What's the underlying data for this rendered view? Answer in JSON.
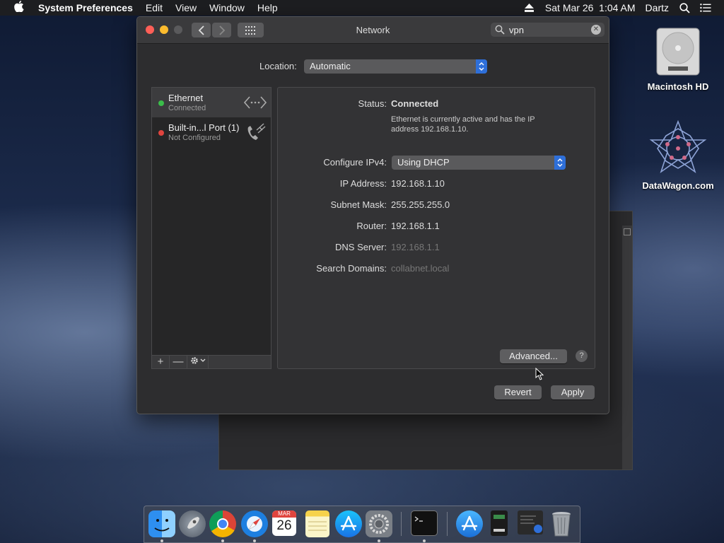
{
  "menubar": {
    "app": "System Preferences",
    "items": [
      "Edit",
      "View",
      "Window",
      "Help"
    ],
    "datetime": "Sat Mar 26  1:04 AM",
    "user": "Dartz"
  },
  "window": {
    "title": "Network",
    "search_value": "vpn",
    "location_label": "Location:",
    "location_value": "Automatic"
  },
  "services": [
    {
      "name": "Ethernet",
      "status": "Connected",
      "status_color": "#3bbd4a"
    },
    {
      "name": "Built-in...l Port (1)",
      "status": "Not Configured",
      "status_color": "#e0443e"
    }
  ],
  "sidebar_buttons": {
    "add": "+",
    "remove": "—"
  },
  "details": {
    "status_label": "Status:",
    "status_value": "Connected",
    "status_note": "Ethernet is currently active and has the IP address 192.168.1.10.",
    "ipv4_label": "Configure IPv4:",
    "ipv4_value": "Using DHCP",
    "ip_label": "IP Address:",
    "ip_value": "192.168.1.10",
    "mask_label": "Subnet Mask:",
    "mask_value": "255.255.255.0",
    "router_label": "Router:",
    "router_value": "192.168.1.1",
    "dns_label": "DNS Server:",
    "dns_value": "192.168.1.1",
    "domains_label": "Search Domains:",
    "domains_value": "collabnet.local"
  },
  "buttons": {
    "advanced": "Advanced...",
    "help": "?",
    "revert": "Revert",
    "apply": "Apply"
  },
  "desktop": [
    {
      "label": "Macintosh HD"
    },
    {
      "label": "DataWagon.com"
    }
  ],
  "dock": {
    "calendar_month": "MAR",
    "calendar_day": "26"
  },
  "colors": {
    "accent": "#2e6fd9",
    "connected": "#3bbd4a",
    "not_configured": "#e0443e"
  }
}
